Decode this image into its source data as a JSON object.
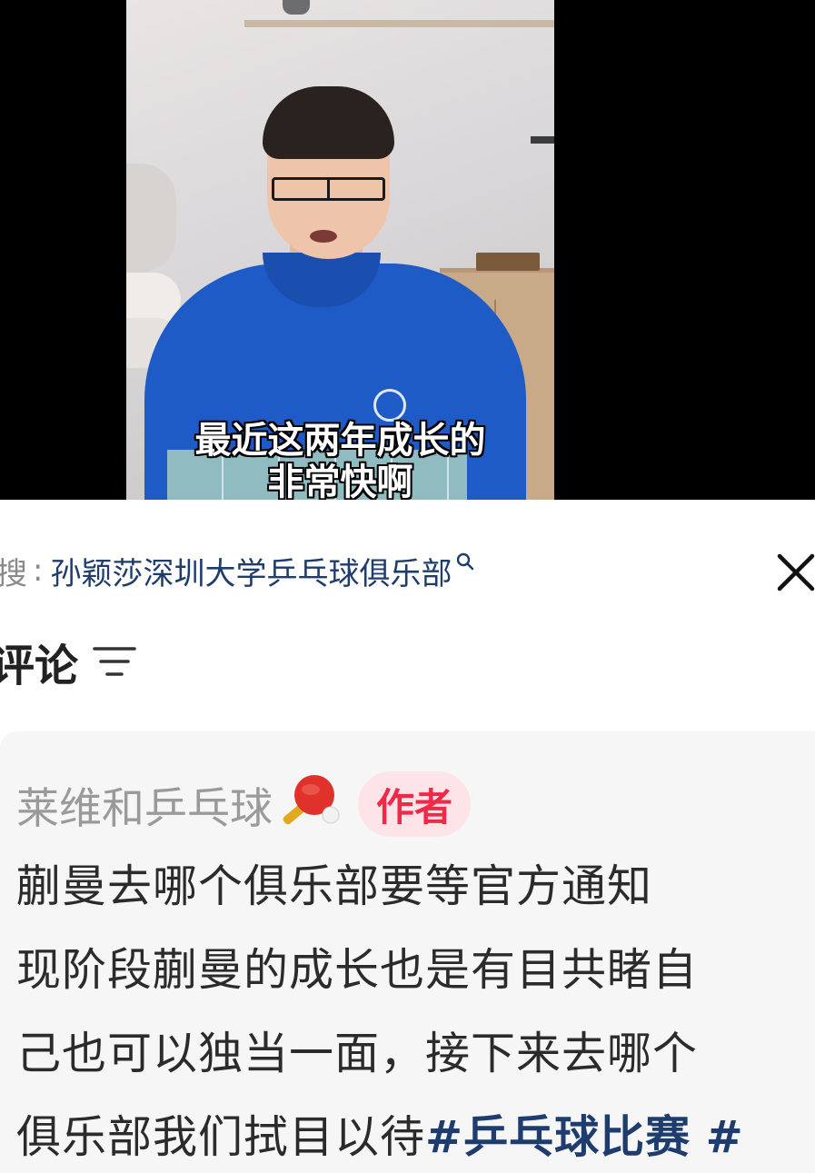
{
  "video": {
    "subtitle_line1": "最近这两年成长的",
    "subtitle_line2": "非常快啊"
  },
  "search": {
    "prefix": "搜",
    "separator": ":",
    "term": "孙颖莎深圳大学乒乓球俱乐部",
    "icon": "search-icon"
  },
  "close": {
    "icon": "close-icon"
  },
  "comments": {
    "title": "评论",
    "sort_icon": "sort-filter-icon"
  },
  "comment": {
    "author": "莱维和乒乓球",
    "author_icon": "ping-pong-paddle-icon",
    "badge": "作者",
    "lines": [
      "蒯曼去哪个俱乐部要等官方通知",
      "现阶段蒯曼的成长也是有目共睹自",
      "己也可以独当一面，接下来去哪个"
    ],
    "last_line_text": "俱乐部我们拭目以待",
    "hashtag1": "#乒乓球比赛",
    "hashtag2": "#"
  },
  "colors": {
    "link": "#1e3d6e",
    "badge_text": "#ef2a48",
    "badge_bg": "#fde4e8",
    "card_bg": "#f6f6f6"
  }
}
